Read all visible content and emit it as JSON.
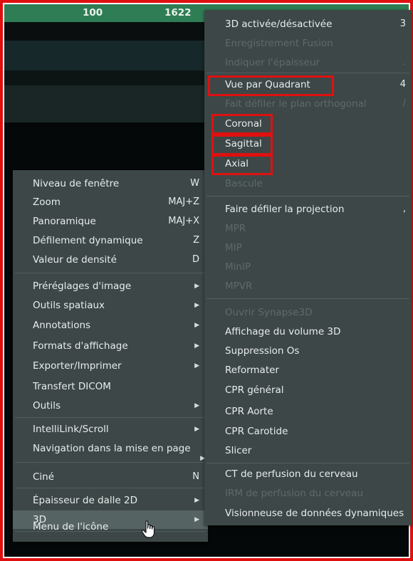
{
  "header": {
    "value_a": "100",
    "value_b": "1622"
  },
  "context_menu": {
    "items": [
      {
        "label": "Niveau de fenêtre",
        "shortcut": "W"
      },
      {
        "label": "Zoom",
        "shortcut": "MAJ+Z"
      },
      {
        "label": "Panoramique",
        "shortcut": "MAJ+X"
      },
      {
        "label": "Défilement dynamique",
        "shortcut": "Z"
      },
      {
        "label": "Valeur de densité",
        "shortcut": "D"
      },
      {
        "label": "Préréglages d'image"
      },
      {
        "label": "Outils spatiaux"
      },
      {
        "label": "Annotations"
      },
      {
        "label": "Formats d'affichage"
      },
      {
        "label": "Exporter/Imprimer"
      },
      {
        "label": "Transfert DICOM"
      },
      {
        "label": "Outils"
      },
      {
        "label": "IntelliLink/Scroll"
      },
      {
        "label": "Navigation dans la mise en page"
      },
      {
        "label": "Ciné",
        "shortcut": "N"
      },
      {
        "label": "Épaisseur de dalle 2D"
      },
      {
        "label": "3D"
      },
      {
        "label": "Menu de l'icône"
      }
    ]
  },
  "submenu_3d": {
    "items": [
      {
        "label": "3D activée/désactivée",
        "shortcut": "3"
      },
      {
        "label": "Enregistrement Fusion"
      },
      {
        "label": "Indiquer l'épaisseur",
        "shortcut": "."
      },
      {
        "label": "Vue par Quadrant",
        "shortcut": "4"
      },
      {
        "label": "Fait défiler le plan orthogonal",
        "shortcut": "/"
      },
      {
        "label": "Coronal"
      },
      {
        "label": "Sagittal"
      },
      {
        "label": "Axial"
      },
      {
        "label": "Bascule"
      },
      {
        "label": "Faire défiler la projection",
        "shortcut": ","
      },
      {
        "label": "MPR"
      },
      {
        "label": "MIP"
      },
      {
        "label": "MinIP"
      },
      {
        "label": "MPVR"
      },
      {
        "label": "Ouvrir Synapse3D"
      },
      {
        "label": "Affichage du volume 3D"
      },
      {
        "label": "Suppression Os"
      },
      {
        "label": "Reformater"
      },
      {
        "label": "CPR général"
      },
      {
        "label": "CPR Aorte"
      },
      {
        "label": "CPR Carotide"
      },
      {
        "label": "Slicer"
      },
      {
        "label": "CT de perfusion du cerveau"
      },
      {
        "label": "IRM de perfusion du cerveau"
      },
      {
        "label": "Visionneuse de données dynamiques"
      }
    ]
  },
  "bottom_caret": "^",
  "colors": {
    "menu_bg": "#3d4747",
    "menu_hover": "#566363",
    "disabled_text": "#5e6a6a",
    "highlight_red": "#e01010",
    "header_green": "#2f7d55"
  }
}
